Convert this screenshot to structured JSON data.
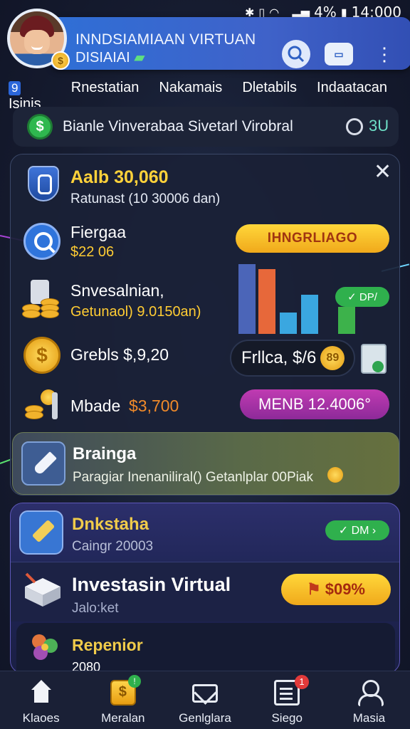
{
  "status_bar": {
    "battery": "4%",
    "time": "14:000"
  },
  "header": {
    "title_line1": "INNDSIAMIAAN VIRTUAN",
    "title_line2": "DISIAIAI",
    "money_icon": "money-icon",
    "avatar_badge": "$"
  },
  "tabs": [
    {
      "num": "9",
      "label": "Isinis"
    },
    {
      "label": "Rnestatian"
    },
    {
      "label": "Nakamais"
    },
    {
      "label": "Dletabils"
    },
    {
      "label": "Indaatacan"
    }
  ],
  "balance": {
    "icon": "$",
    "text": "Bianle Vinverabaa Sivetarl Virobral",
    "value": "3U"
  },
  "card": {
    "title": "Aalb 30,060",
    "subtitle": "Ratunast (10 30006 dan)",
    "rows": [
      {
        "label": "Fiergaa",
        "value": "$22 06"
      },
      {
        "label": "Snvesalnian,",
        "value": "Getunaol) 9.0150an)"
      },
      {
        "label": "Grebls $,9,20",
        "value": ""
      },
      {
        "label": "Mbade",
        "value": "$3,700"
      }
    ],
    "pill_yellow": "IHNGRLIAGO",
    "pill_green": "✓ DP/",
    "pill_dark": "Frllca, $/6",
    "pill_dark_coin": "89",
    "pill_magenta": "MENB 12.4006°",
    "bars": [
      {
        "value": 0.82,
        "color": "#4b65b8"
      },
      {
        "value": 0.76,
        "color": "#e7683a"
      },
      {
        "value": 0.25,
        "color": "#3aa7e0"
      },
      {
        "value": 0.46,
        "color": "#3aa7e0"
      },
      {
        "value": 0.32,
        "color": "#3db24b"
      }
    ],
    "promo": {
      "title": "Brainga",
      "subtitle": "Paragiar Inenaniliral() Getanlplar 00Piak"
    }
  },
  "card2": {
    "item1": {
      "title": "Dnkstaha",
      "subtitle": "Caingr 20003",
      "pill": "✓ DM ›"
    },
    "item2": {
      "title": "Investasin Virtual",
      "subtitle": "Jalo:ket",
      "pill": "$09%"
    },
    "item3": {
      "title": "Repenior",
      "subtitle": "2080"
    }
  },
  "nav": [
    {
      "label": "Klaoes",
      "icon": "home-icon"
    },
    {
      "label": "Meralan",
      "icon": "wallet-icon",
      "badge": "!"
    },
    {
      "label": "Genlglara",
      "icon": "mail-icon"
    },
    {
      "label": "Siego",
      "icon": "document-icon",
      "badge": "1"
    },
    {
      "label": "Masia",
      "icon": "user-icon"
    }
  ]
}
